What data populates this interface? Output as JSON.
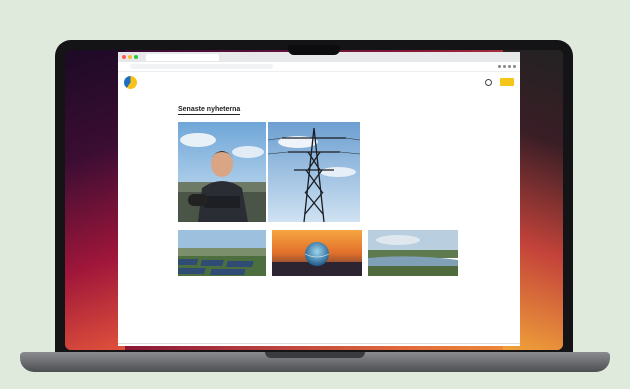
{
  "browser": {
    "tab_title": "",
    "url": ""
  },
  "site": {
    "nav": [
      "",
      "",
      ""
    ],
    "heading": "Senaste nyheterna"
  },
  "featured": {
    "meta": "",
    "title": "",
    "text": ""
  },
  "cards": [
    {
      "meta": "",
      "title": "",
      "text": ""
    },
    {
      "meta": "",
      "title": "",
      "text": ""
    },
    {
      "meta": "",
      "title": "",
      "text": ""
    }
  ],
  "colors": {
    "background": "#dfe9dc",
    "accent_yellow": "#f5c518",
    "wallpaper_red": "#a0163a"
  }
}
